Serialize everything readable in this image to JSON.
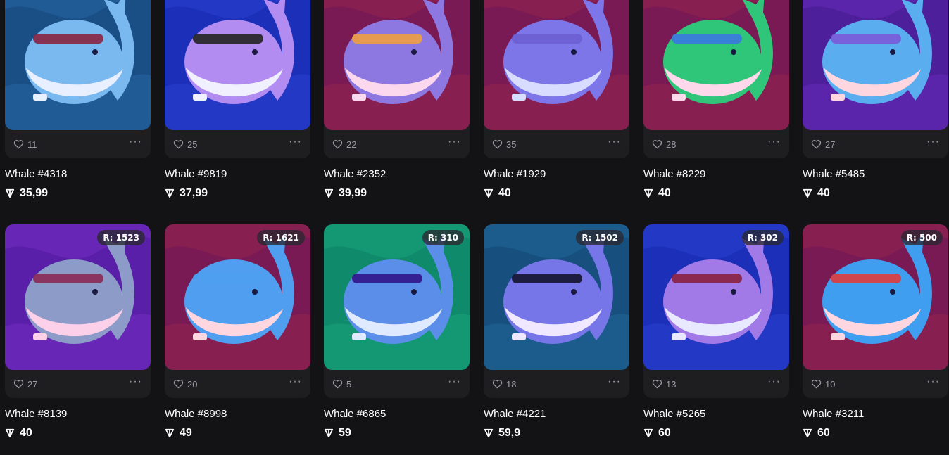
{
  "items": [
    {
      "name": "Whale #4318",
      "price": "35,99",
      "likes": "11",
      "rank": "",
      "bg": "#1a4f86",
      "bg2": "#2a6aa8",
      "body": "#7ab8f0",
      "belly": "#e8f0ff",
      "acc": "#8a2340"
    },
    {
      "name": "Whale #9819",
      "price": "37,99",
      "likes": "25",
      "rank": "",
      "bg": "#1b2fb8",
      "bg2": "#2e48d8",
      "body": "#b28cf0",
      "belly": "#f0f0ff",
      "acc": "#222222"
    },
    {
      "name": "Whale #2352",
      "price": "39,99",
      "likes": "22",
      "rank": "",
      "bg": "#7a1a55",
      "bg2": "#99264d",
      "body": "#8c78e0",
      "belly": "#fbd8ee",
      "acc": "#f0a040"
    },
    {
      "name": "Whale #1929",
      "price": "40",
      "likes": "35",
      "rank": "",
      "bg": "#7a1a55",
      "bg2": "#99264d",
      "body": "#7d76e8",
      "belly": "#d8dcff",
      "acc": "#6d5fd0"
    },
    {
      "name": "Whale #8229",
      "price": "40",
      "likes": "28",
      "rank": "",
      "bg": "#7a1a55",
      "bg2": "#99264d",
      "body": "#2fc67a",
      "belly": "#fdd8ea",
      "acc": "#3b78e0"
    },
    {
      "name": "Whale #5485",
      "price": "40",
      "likes": "27",
      "rank": "",
      "bg": "#4d1f9a",
      "bg2": "#6a2cc0",
      "body": "#5aaef0",
      "belly": "#fdd6e0",
      "acc": "#7a5ad8"
    },
    {
      "name": "Whale #8139",
      "price": "40",
      "likes": "27",
      "rank": "R: 1523",
      "bg": "#5a1fa8",
      "bg2": "#7a2ec8",
      "body": "#8d9bc8",
      "belly": "#fcd0e8",
      "acc": "#8a2a55"
    },
    {
      "name": "Whale #8998",
      "price": "49",
      "likes": "20",
      "rank": "R: 1621",
      "bg": "#7a1a55",
      "bg2": "#99264d",
      "body": "#4f9ef0",
      "belly": "#fdd6e0",
      "acc": "#4f9ef0"
    },
    {
      "name": "Whale #6865",
      "price": "59",
      "likes": "5",
      "rank": "R: 310",
      "bg": "#0f8a6a",
      "bg2": "#1aa87f",
      "body": "#5a8ee8",
      "belly": "#e0eaff",
      "acc": "#30148a"
    },
    {
      "name": "Whale #4221",
      "price": "59,9",
      "likes": "18",
      "rank": "R: 1502",
      "bg": "#17507e",
      "bg2": "#226a9e",
      "body": "#7676e8",
      "belly": "#f0e8ff",
      "acc": "#141430"
    },
    {
      "name": "Whale #5265",
      "price": "60",
      "likes": "13",
      "rank": "R: 302",
      "bg": "#1b2fb8",
      "bg2": "#2e48d8",
      "body": "#a27ae8",
      "belly": "#e8e8ff",
      "acc": "#8a2040"
    },
    {
      "name": "Whale #3211",
      "price": "60",
      "likes": "10",
      "rank": "R: 500",
      "bg": "#7a1a55",
      "bg2": "#99264d",
      "body": "#3f9ef0",
      "belly": "#fdd6e0",
      "acc": "#e03a3a"
    }
  ],
  "icons": {
    "like": "heart-icon",
    "more": "ellipsis-icon",
    "currency": "ton-icon"
  },
  "more_glyph": "···"
}
